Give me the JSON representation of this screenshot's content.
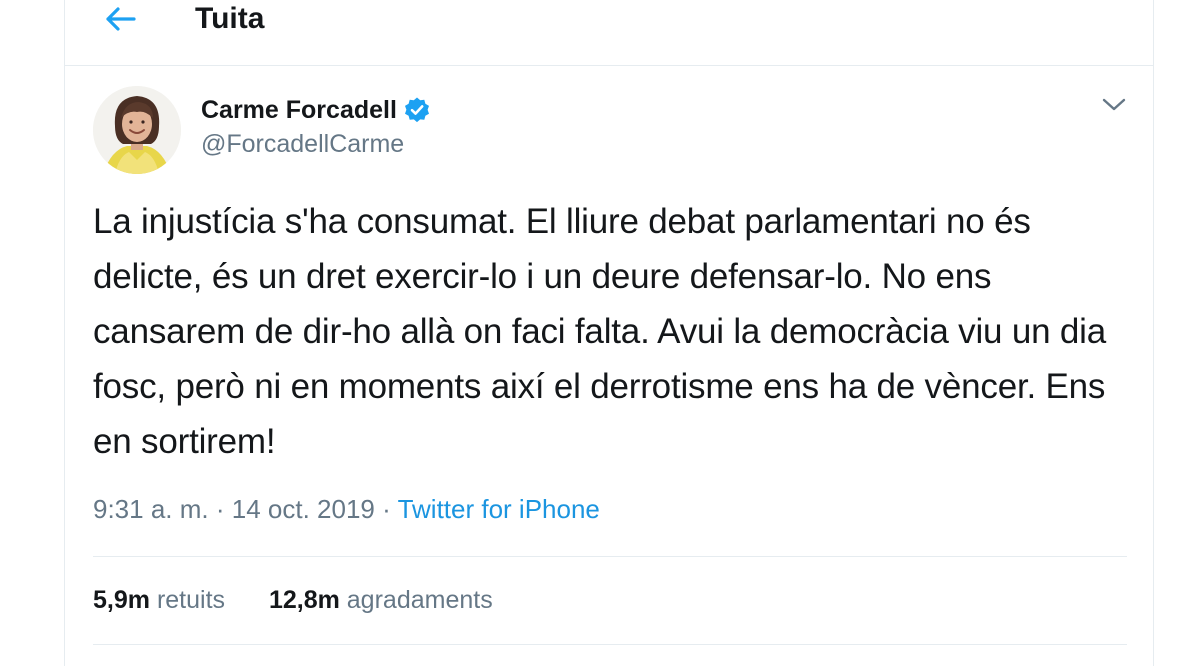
{
  "header": {
    "back_icon": "arrow-left-icon",
    "title": "Tuita"
  },
  "tweet": {
    "author": {
      "name": "Carme Forcadell",
      "handle": "@ForcadellCarme",
      "verified": true,
      "verified_icon": "verified-badge-icon"
    },
    "more_icon": "chevron-down-icon",
    "text": "La injustícia s'ha consumat. El lliure debat parlamentari no és delicte, és un dret exercir-lo i un deure defensar-lo. No ens cansarem de dir-ho allà on faci falta. Avui la democràcia viu un dia fosc, però ni en moments així el derrotisme ens ha de vèncer. Ens en sortirem!",
    "time": "9:31 a. m.",
    "separator": "·",
    "date": "14 oct. 2019",
    "source": "Twitter for iPhone",
    "stats": {
      "retweets_count": "5,9m",
      "retweets_label": "retuits",
      "likes_count": "12,8m",
      "likes_label": "agradaments"
    }
  },
  "colors": {
    "accent": "#1da1f2",
    "link": "#1b95e0",
    "secondary_text": "#657786",
    "primary_text": "#14171a",
    "border": "#e6ecf0"
  }
}
